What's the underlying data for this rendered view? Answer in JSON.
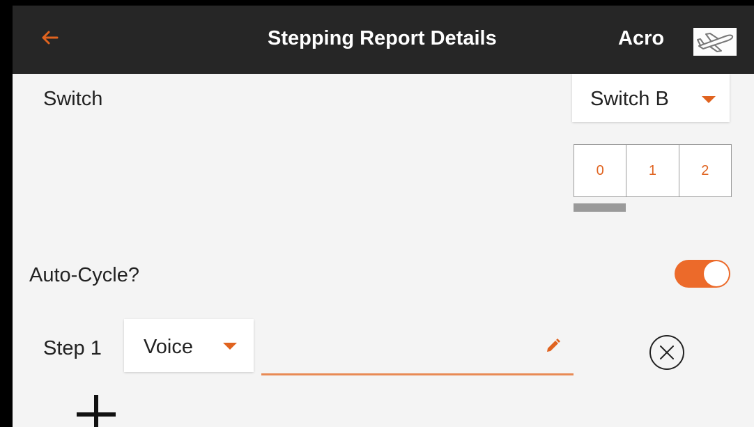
{
  "header": {
    "back_icon": "arrow-left-icon",
    "title": "Stepping Report Details",
    "mode": "Acro",
    "model_icon": "airplane-icon"
  },
  "switch_row": {
    "label": "Switch",
    "selected": "Switch B",
    "caret_icon": "caret-down-icon"
  },
  "positions": {
    "items": [
      "0",
      "1",
      "2"
    ],
    "active_index": 0
  },
  "auto_cycle": {
    "label": "Auto-Cycle?",
    "enabled": true
  },
  "steps": [
    {
      "label": "Step 1",
      "type": "Voice",
      "value": "",
      "edit_icon": "pencil-icon",
      "remove_icon": "close-circle-icon"
    }
  ],
  "add_icon": "plus-icon",
  "colors": {
    "accent": "#e0631f",
    "header_bg": "#262626",
    "page_bg": "#f4f4f4"
  }
}
